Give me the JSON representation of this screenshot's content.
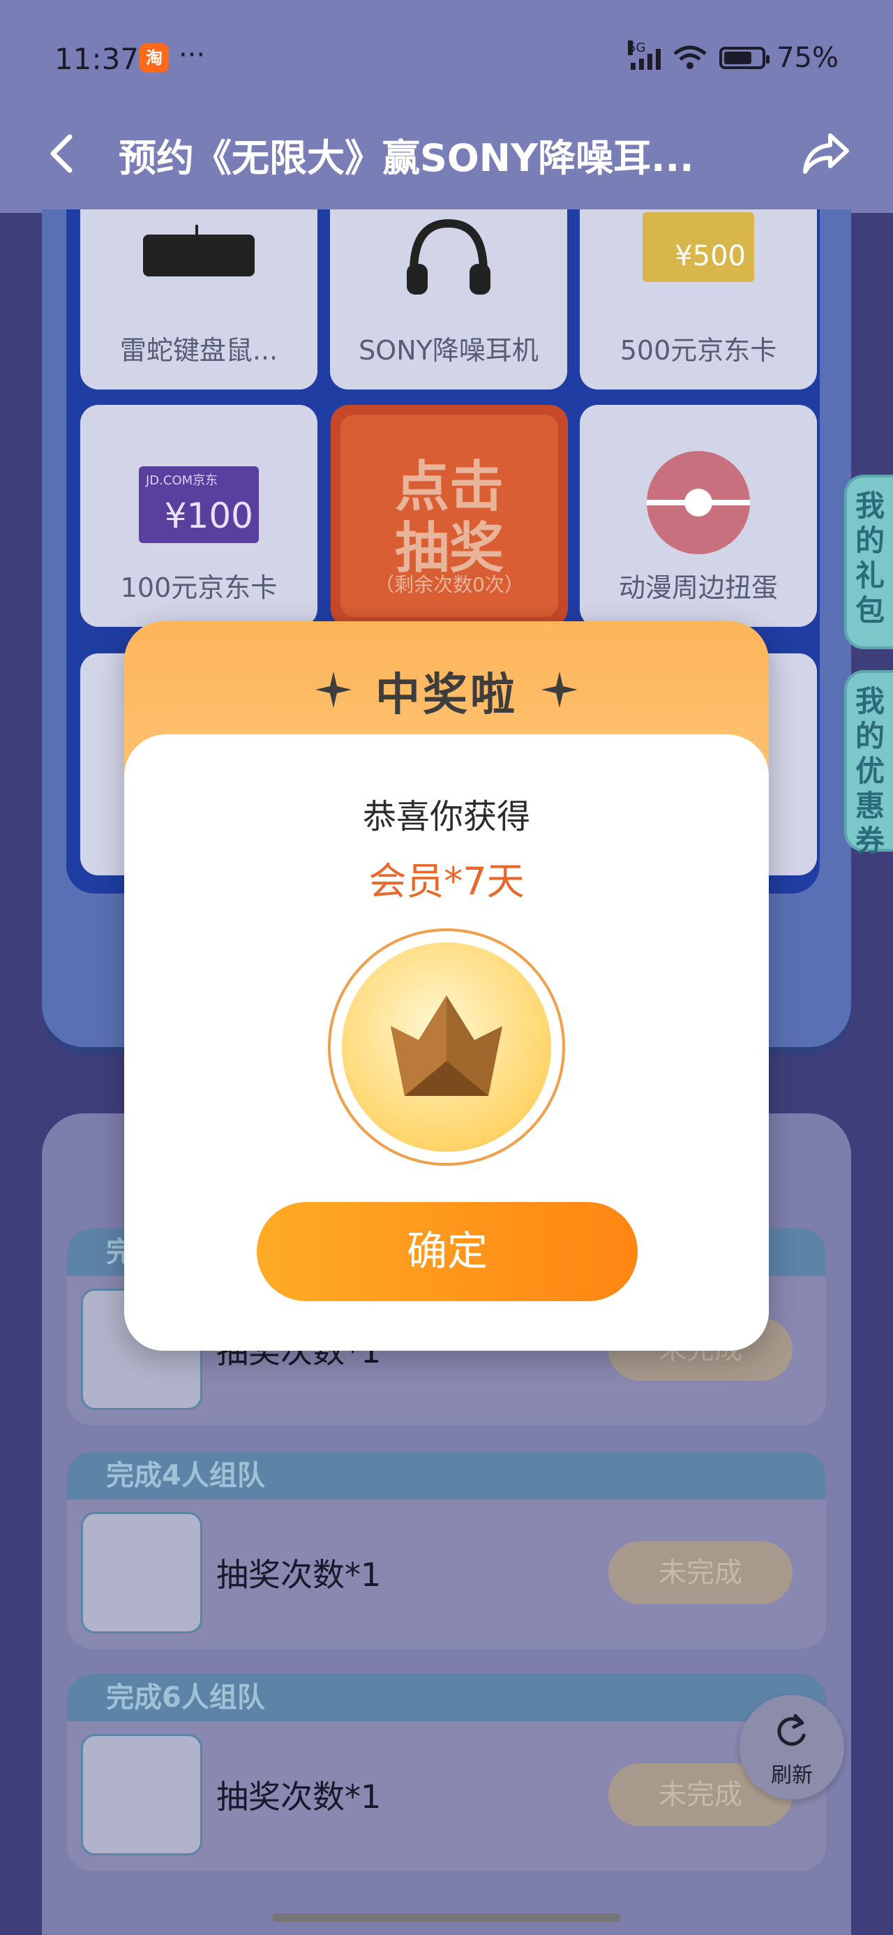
{
  "status_bar": {
    "time": "11:37",
    "app_badge": "淘",
    "more": "···",
    "network": "5G",
    "battery": "75%"
  },
  "header": {
    "title": "预约《无限大》赢SONY降噪耳...",
    "back_icon": "chevron-left-icon",
    "share_icon": "share-icon"
  },
  "prizes": [
    {
      "label": "雷蛇键盘鼠...",
      "icon": "keyboard-icon"
    },
    {
      "label": "SONY降噪耳机",
      "icon": "headphones-icon"
    },
    {
      "label": "500元京东卡",
      "icon": "gift-card-icon",
      "card_value": "¥500"
    },
    {
      "label": "100元京东卡",
      "icon": "gift-card-icon",
      "card_value": "¥100",
      "card_brand": "JD.COM京东"
    },
    {
      "label": "动漫周边扭蛋",
      "icon": "capsule-toy-icon"
    }
  ],
  "draw": {
    "label_line1": "点击",
    "label_line2": "抽奖",
    "remaining": "（剩余次数0次）"
  },
  "side_tabs": {
    "gift": "我的礼包",
    "coupon": "我的优惠券"
  },
  "tasks": [
    {
      "head": "完",
      "name": "抽奖次数*1",
      "status": "未完成"
    },
    {
      "head": "完成4人组队",
      "name": "抽奖次数*1",
      "status": "未完成"
    },
    {
      "head": "完成6人组队",
      "name": "抽奖次数*1",
      "status": "未完成"
    }
  ],
  "refresh": {
    "label": "刷新"
  },
  "modal": {
    "title": "中奖啦",
    "congrats": "恭喜你获得",
    "reward": "会员*7天",
    "confirm": "确定"
  },
  "colors": {
    "accent_orange": "#ff8a14",
    "reward_text": "#e8682a",
    "header_bg": "#797eb7"
  }
}
